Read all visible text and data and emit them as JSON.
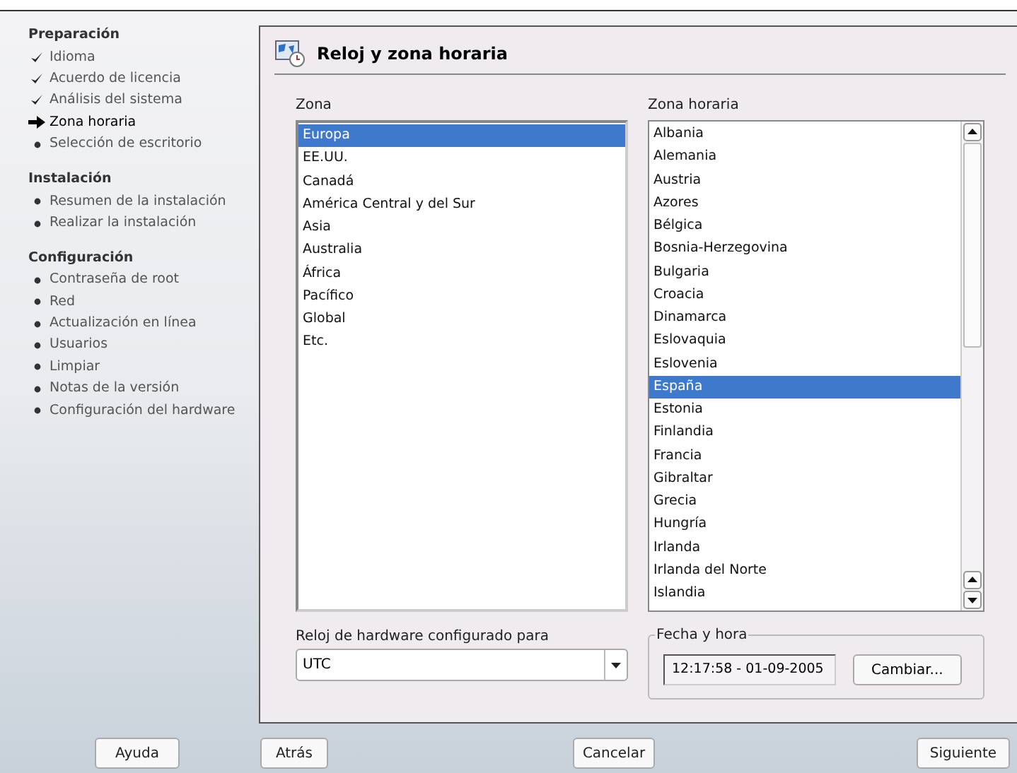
{
  "sidebar": {
    "sections": [
      {
        "title": "Preparación",
        "items": [
          {
            "label": "Idioma",
            "kind": "done"
          },
          {
            "label": "Acuerdo de licencia",
            "kind": "done"
          },
          {
            "label": "Análisis del sistema",
            "kind": "done"
          },
          {
            "label": "Zona horaria",
            "kind": "current"
          },
          {
            "label": "Selección de escritorio",
            "kind": "pending"
          }
        ]
      },
      {
        "title": "Instalación",
        "items": [
          {
            "label": "Resumen de la instalación",
            "kind": "pending"
          },
          {
            "label": "Realizar la instalación",
            "kind": "pending"
          }
        ]
      },
      {
        "title": "Configuración",
        "items": [
          {
            "label": "Contraseña de root",
            "kind": "pending"
          },
          {
            "label": "Red",
            "kind": "pending"
          },
          {
            "label": "Actualización en línea",
            "kind": "pending"
          },
          {
            "label": "Usuarios",
            "kind": "pending"
          },
          {
            "label": "Limpiar",
            "kind": "pending"
          },
          {
            "label": "Notas de la versión",
            "kind": "pending"
          },
          {
            "label": "Configuración del hardware",
            "kind": "pending"
          }
        ]
      }
    ]
  },
  "panel": {
    "title": "Reloj y zona horaria",
    "zone": {
      "label": "Zona",
      "items": [
        {
          "label": "Europa",
          "selected": true
        },
        {
          "label": "EE.UU.",
          "selected": false
        },
        {
          "label": "Canadá",
          "selected": false
        },
        {
          "label": "América Central y del Sur",
          "selected": false
        },
        {
          "label": "Asia",
          "selected": false
        },
        {
          "label": "Australia",
          "selected": false
        },
        {
          "label": "África",
          "selected": false
        },
        {
          "label": "Pacífico",
          "selected": false
        },
        {
          "label": "Global",
          "selected": false
        },
        {
          "label": "Etc.",
          "selected": false
        }
      ]
    },
    "timezone": {
      "label": "Zona horaria",
      "items": [
        {
          "label": "Albania",
          "selected": false
        },
        {
          "label": "Alemania",
          "selected": false
        },
        {
          "label": "Austria",
          "selected": false
        },
        {
          "label": "Azores",
          "selected": false
        },
        {
          "label": "Bélgica",
          "selected": false
        },
        {
          "label": "Bosnia-Herzegovina",
          "selected": false
        },
        {
          "label": "Bulgaria",
          "selected": false
        },
        {
          "label": "Croacia",
          "selected": false
        },
        {
          "label": "Dinamarca",
          "selected": false
        },
        {
          "label": "Eslovaquia",
          "selected": false
        },
        {
          "label": "Eslovenia",
          "selected": false
        },
        {
          "label": "España",
          "selected": true
        },
        {
          "label": "Estonia",
          "selected": false
        },
        {
          "label": "Finlandia",
          "selected": false
        },
        {
          "label": "Francia",
          "selected": false
        },
        {
          "label": "Gibraltar",
          "selected": false
        },
        {
          "label": "Grecia",
          "selected": false
        },
        {
          "label": "Hungría",
          "selected": false
        },
        {
          "label": "Irlanda",
          "selected": false
        },
        {
          "label": "Irlanda del Norte",
          "selected": false
        },
        {
          "label": "Islandia",
          "selected": false
        }
      ]
    },
    "hardware_clock": {
      "label": "Reloj de hardware configurado para",
      "value": "UTC"
    },
    "date_time": {
      "title": "Fecha y hora",
      "value": "12:17:58 - 01-09-2005",
      "button": {
        "label": "Cambiar..."
      }
    }
  },
  "buttons": [
    {
      "label": "Ayuda",
      "kind": "help"
    },
    {
      "label": "Atrás",
      "kind": "back"
    },
    {
      "label": "Cancelar",
      "kind": "cancel"
    },
    {
      "label": "Siguiente",
      "kind": "next"
    }
  ]
}
